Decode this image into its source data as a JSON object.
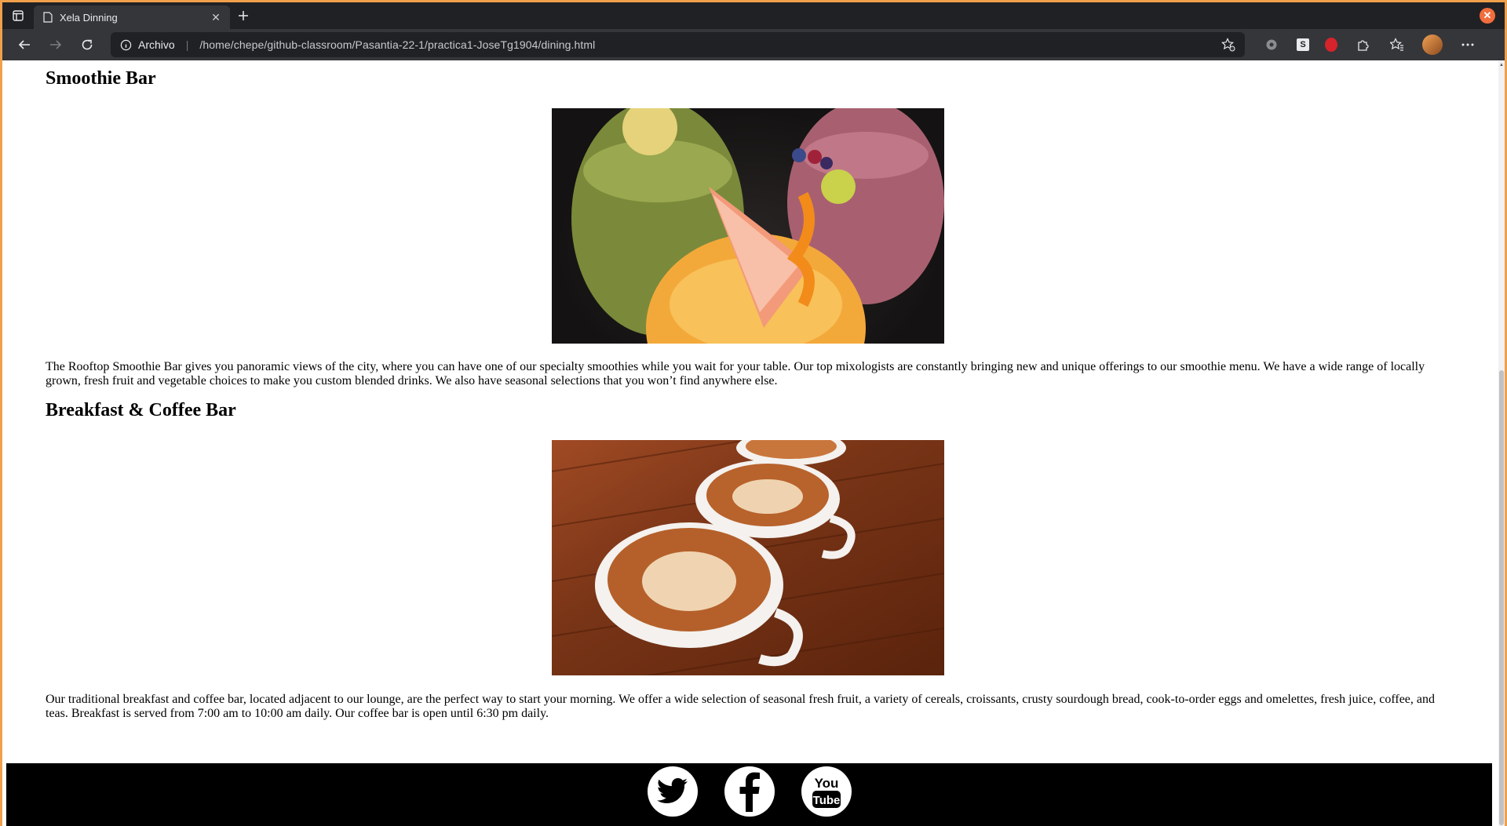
{
  "browser": {
    "tab_title": "Xela Dinning",
    "omnibox_label": "Archivo",
    "url": "/home/chepe/github-classroom/Pasantia-22-1/practica1-JoseTg1904/dining.html"
  },
  "page": {
    "smoothie": {
      "heading": "Smoothie Bar",
      "description": "The Rooftop Smoothie Bar gives you panoramic views of the city, where you can have one of our specialty smoothies while you wait for your table. Our top mixologists are constantly bringing new and unique offerings to our smoothie menu. We have a wide range of locally grown, fresh fruit and vegetable choices to make you custom blended drinks. We also have seasonal selections that you won’t find anywhere else."
    },
    "breakfast": {
      "heading": "Breakfast & Coffee Bar",
      "description": "Our traditional breakfast and coffee bar, located adjacent to our lounge, are the perfect way to start your morning. We offer a wide selection of seasonal fresh fruit, a variety of cereals, croissants, crusty sourdough bread, cook-to-order eggs and omelettes, fresh juice, coffee, and teas. Breakfast is served from 7:00 am to 10:00 am daily. Our coffee bar is open until 6:30 pm daily."
    },
    "footer": {
      "social": [
        "twitter-icon",
        "facebook-icon",
        "youtube-icon"
      ],
      "youtube_logo_text_top": "You",
      "youtube_logo_text_bottom": "Tube"
    }
  },
  "colors": {
    "frame_accent": "#f0a04b",
    "tabstrip_bg": "#202124",
    "toolbar_bg": "#35363a",
    "footer_bg": "#000000"
  }
}
